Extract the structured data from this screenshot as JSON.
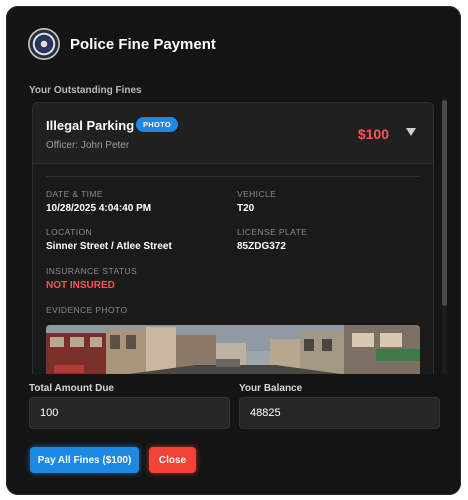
{
  "header": {
    "title": "Police Fine Payment",
    "seal_icon": "police-seal-icon"
  },
  "fines_section": {
    "label": "Your Outstanding Fines"
  },
  "fines": [
    {
      "violation": "Illegal Parking",
      "badge": "PHOTO",
      "officer": "Officer: John Peter",
      "amount": "$100",
      "details": {
        "date_time_label": "DATE & TIME",
        "date_time": "10/28/2025 4:04:40 PM",
        "vehicle_label": "VEHICLE",
        "vehicle": "T20",
        "location_label": "LOCATION",
        "location": "Sinner Street / Atlee Street",
        "plate_label": "LICENSE PLATE",
        "plate": "85ZDG372",
        "insurance_label": "INSURANCE STATUS",
        "insurance": "NOT INSURED",
        "evidence_label": "EVIDENCE PHOTO"
      }
    }
  ],
  "totals": {
    "due_label": "Total Amount Due",
    "due_value": "100",
    "balance_label": "Your Balance",
    "balance_value": "48825"
  },
  "actions": {
    "pay_label": "Pay All Fines ($100)",
    "close_label": "Close"
  },
  "colors": {
    "accent": "#1e88e5",
    "danger": "#f44336",
    "fine_amount": "#ff5252",
    "background": "#141414"
  }
}
